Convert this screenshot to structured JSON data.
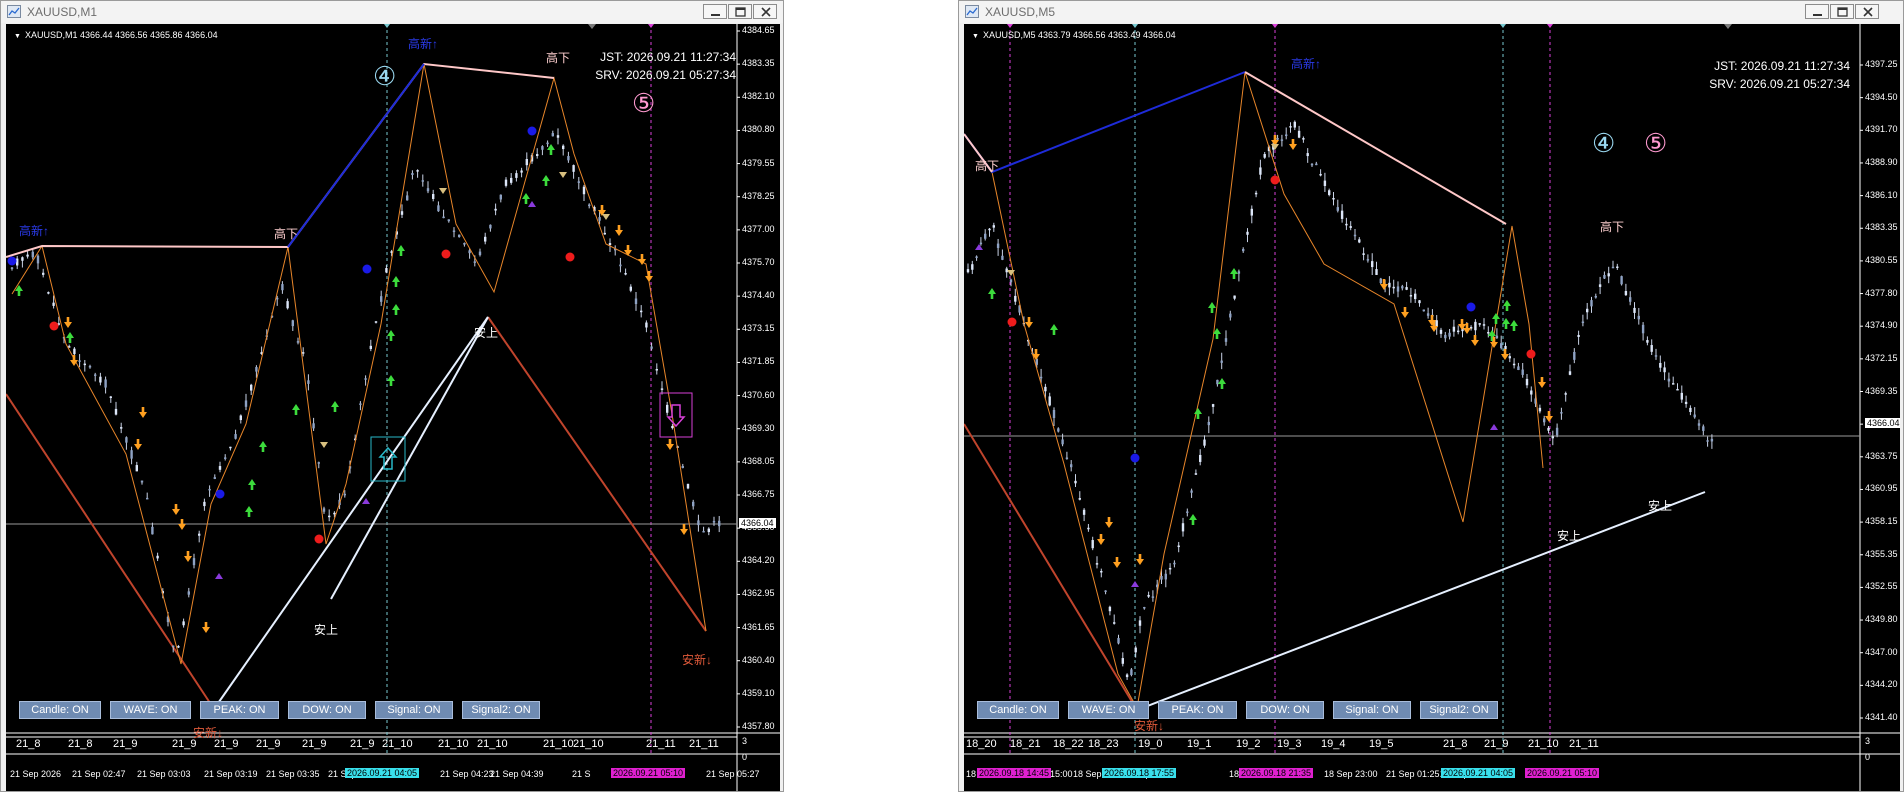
{
  "windows": [
    {
      "id": "m1",
      "title": "XAUUSD,M1",
      "symbol_line": "XAUUSD,M1  4366.44 4366.56 4365.86 4366.04",
      "jst": "JST: 2026.09.21 11:27:34",
      "srv": "SRV: 2026.09.21 05:27:34",
      "price_axis": [
        "4384.65",
        "4383.35",
        "4382.10",
        "4380.80",
        "4379.55",
        "4378.25",
        "4377.00",
        "4375.70",
        "4374.40",
        "4373.15",
        "4371.85",
        "4370.60",
        "4369.30",
        "4368.05",
        "4366.75",
        "4365.50",
        "4364.20",
        "4362.95",
        "4361.65",
        "4360.40",
        "4359.10",
        "4357.80"
      ],
      "current_price": "4366.04",
      "subwindow_axis": [
        "3",
        "0"
      ],
      "bar_labels": [
        "21_8",
        "21_8",
        "21_9",
        "21_9",
        "21_9",
        "21_9",
        "21_9",
        "21_9",
        "21_10",
        "21_10",
        "21_10",
        "21_10",
        "21_10",
        "21_11",
        "21_11"
      ],
      "time_axis": [
        "21 Sep 2026",
        "21 Sep 02:47",
        "21 Sep 03:03",
        "21 Sep 03:19",
        "21 Sep 03:35",
        "21 Sep 0",
        "21 Sep 04:23",
        "21 Sep 04:39",
        "21 S",
        "21 Sep 05:27"
      ],
      "time_tag_cyan": "2026.09.21 04:05",
      "time_tag_cyan_tail": "4:07",
      "time_tag_magenta": "2026.09.21 05:10",
      "time_tag_magenta_tail": "5:11",
      "labels": {
        "high_break_left": "高新↑",
        "high_break_top": "高新↑",
        "high_lower_1": "高下",
        "high_lower_2": "高下",
        "low_higher_1": "安上",
        "low_higher_2": "安上",
        "low_break_bottom": "安新↓",
        "low_break_right": "安新↓"
      },
      "wave_labels": [
        "④",
        "⑤"
      ],
      "buttons": [
        "Candle: ON",
        "WAVE: ON",
        "PEAK: ON",
        "DOW: ON",
        "Signal: ON",
        "Signal2: ON"
      ]
    },
    {
      "id": "m5",
      "title": "XAUUSD,M5",
      "symbol_line": "XAUUSD,M5  4363.79 4366.56 4363.49 4366.04",
      "jst": "JST: 2026.09.21 11:27:34",
      "srv": "SRV: 2026.09.21 05:27:34",
      "price_axis": [
        "4397.25",
        "4394.50",
        "4391.70",
        "4388.90",
        "4386.10",
        "4383.35",
        "4380.55",
        "4377.80",
        "4374.90",
        "4372.15",
        "4369.35",
        "4366.04",
        "4363.75",
        "4360.95",
        "4358.15",
        "4355.35",
        "4352.55",
        "4349.80",
        "4347.00",
        "4344.20",
        "4341.40"
      ],
      "current_price": "4366.04",
      "subwindow_axis": [
        "3",
        "0"
      ],
      "bar_labels": [
        "18_20",
        "18_21",
        "18_22",
        "18_23",
        "19_0",
        "19_1",
        "19_2",
        "19_3",
        "19_4",
        "19_5",
        "21_8",
        "21_9",
        "21_10",
        "21_11"
      ],
      "time_axis": [
        "18",
        "15:00",
        "18 Sep 1",
        "18 Sep 19:00",
        "18 S",
        "1:40",
        "18 Sep 23:00",
        "21 Sep 01:25",
        "21 Sep",
        "05:25"
      ],
      "time_tags": [
        "2026.09.18 14:45",
        "2026.09.18 17:55",
        "2026.09.18 21:35",
        "2026.09.21 04:05",
        "2026.09.21 05:10"
      ],
      "labels": {
        "high_break_top": "高新↑",
        "high_lower_left": "高下",
        "high_lower_right": "高下",
        "low_break_bottom": "安新↓",
        "low_higher_1": "安上",
        "low_higher_2": "安上"
      },
      "wave_labels": [
        "④",
        "⑤"
      ],
      "buttons": [
        "Candle: ON",
        "WAVE: ON",
        "PEAK: ON",
        "DOW: ON",
        "Signal: ON",
        "Signal2: ON"
      ]
    }
  ],
  "colors": {
    "background": "#000000",
    "candle": "#c8d2e6",
    "zigzag": "#e8862a",
    "wave_up": "#1e2bd8",
    "wave_down": "#ffc8c8",
    "trend_down": "#c0442c",
    "trend_up": "#e6f0ff",
    "signal_up": "#3cdc3c",
    "signal_down": "#ffa020",
    "peak_high": "#ee1c1c",
    "peak_low": "#1a1ae6",
    "dow_purple": "#8a3adc",
    "vline_cyan": "#78c8d0",
    "vline_magenta": "#d840d8",
    "wave4": "#9ad8f0",
    "wave5": "#ff9ad0",
    "button": "#6f8bb2"
  }
}
